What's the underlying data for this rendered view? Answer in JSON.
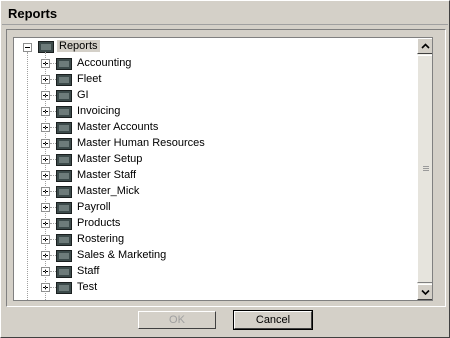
{
  "window": {
    "title": "Reports"
  },
  "tree": {
    "root": {
      "label": "Reports",
      "expanded": true,
      "icon": "report-folder-icon"
    },
    "items": [
      {
        "label": "Accounting"
      },
      {
        "label": "Fleet"
      },
      {
        "label": "GI"
      },
      {
        "label": "Invoicing"
      },
      {
        "label": "Master Accounts"
      },
      {
        "label": "Master Human Resources"
      },
      {
        "label": "Master Setup"
      },
      {
        "label": "Master Staff"
      },
      {
        "label": "Master_Mick"
      },
      {
        "label": "Payroll"
      },
      {
        "label": "Products"
      },
      {
        "label": "Rostering"
      },
      {
        "label": "Sales & Marketing"
      },
      {
        "label": "Staff"
      },
      {
        "label": "Test"
      }
    ]
  },
  "buttons": {
    "ok_label": "OK",
    "cancel_label": "Cancel"
  }
}
